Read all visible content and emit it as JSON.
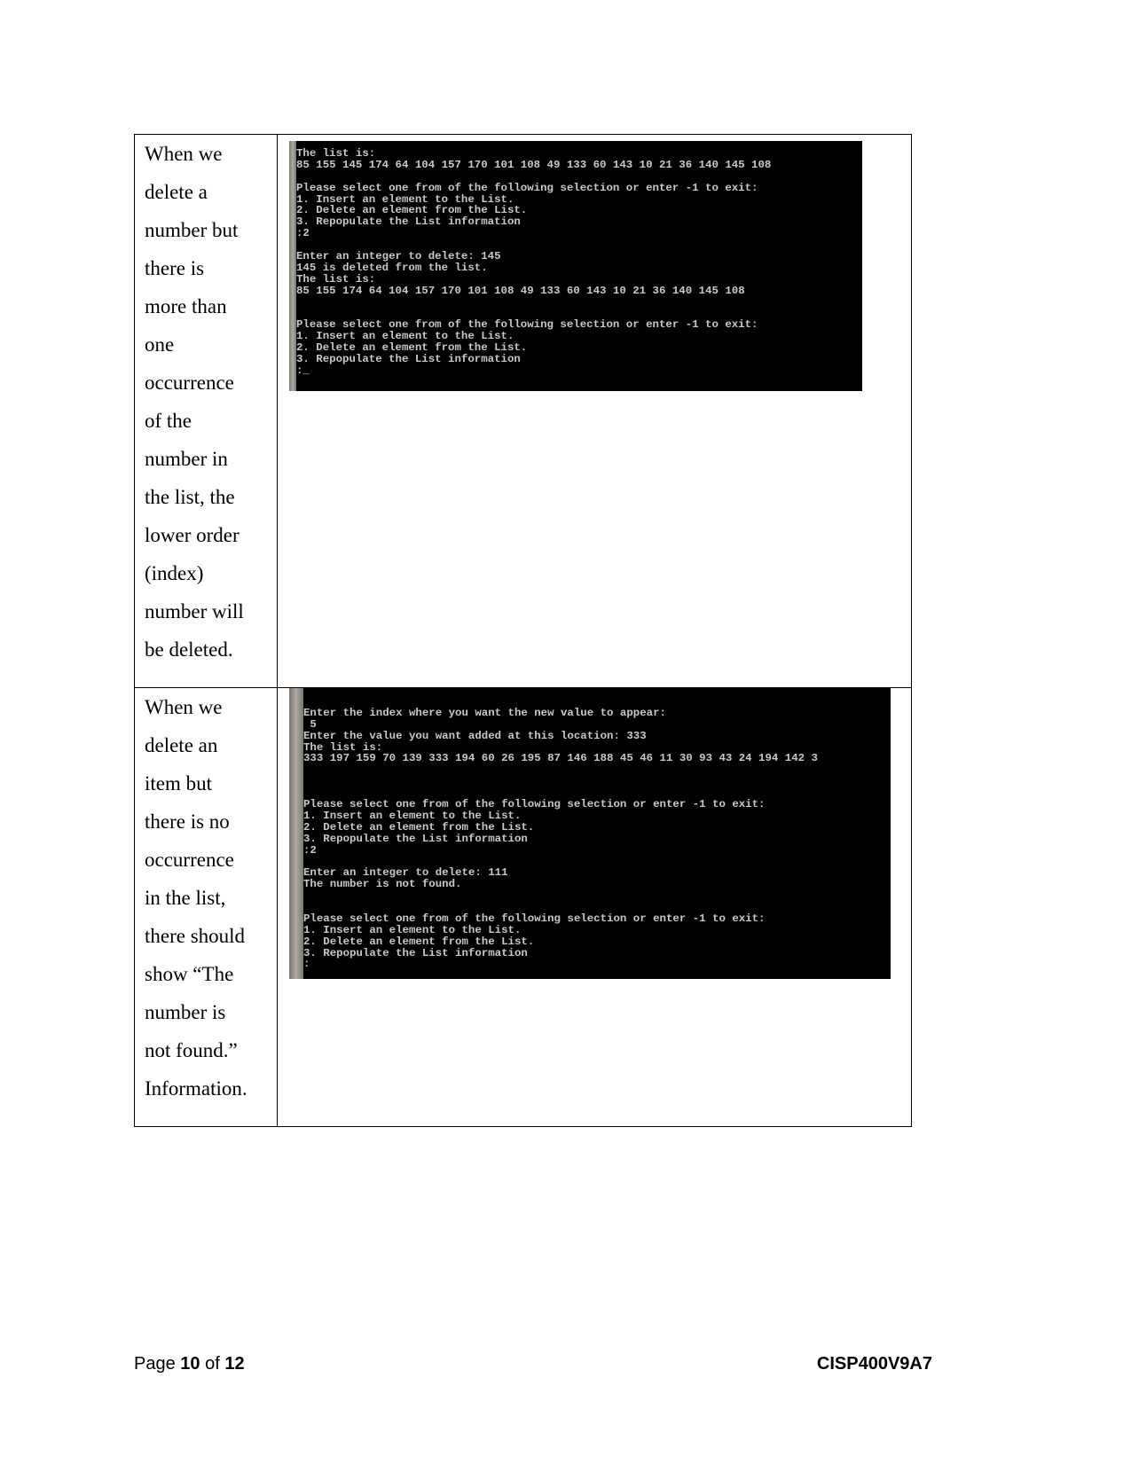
{
  "rows": [
    {
      "description_lines": [
        "When we",
        "delete a",
        "number but",
        "there is",
        "more than",
        "one",
        "occurrence",
        "of the",
        "number in",
        "the list, the",
        "lower order",
        "(index)",
        "number will",
        "be deleted."
      ],
      "console_lines": [
        "The list is:",
        "85 155 145 174 64 104 157 170 101 108 49 133 60 143 10 21 36 140 145 108",
        "",
        "Please select one from of the following selection or enter -1 to exit:",
        "1. Insert an element to the List.",
        "2. Delete an element from the List.",
        "3. Repopulate the List information",
        ":2",
        "",
        "Enter an integer to delete: 145",
        "145 is deleted from the list.",
        "The list is:",
        "85 155 174 64 104 157 170 101 108 49 133 60 143 10 21 36 140 145 108",
        "",
        "",
        "Please select one from of the following selection or enter -1 to exit:",
        "1. Insert an element to the List.",
        "2. Delete an element from the List.",
        "3. Repopulate the List information",
        ":_"
      ]
    },
    {
      "description_lines": [
        "When we",
        "delete an",
        "item but",
        "there is no",
        "occurrence",
        "in the list,",
        "there should",
        "show “The",
        "number is",
        "not found.”",
        "Information."
      ],
      "console_lines": [
        "",
        "Enter the index where you want the new value to appear:",
        " 5",
        "Enter the value you want added at this location: 333",
        "The list is:",
        "333 197 159 70 139 333 194 60 26 195 87 146 188 45 46 11 30 93 43 24 194 142 3",
        "",
        "",
        "",
        "Please select one from of the following selection or enter -1 to exit:",
        "1. Insert an element to the List.",
        "2. Delete an element from the List.",
        "3. Repopulate the List information",
        ":2",
        "",
        "Enter an integer to delete: 111",
        "The number is not found.",
        "",
        "",
        "Please select one from of the following selection or enter -1 to exit:",
        "1. Insert an element to the List.",
        "2. Delete an element from the List.",
        "3. Repopulate the List information",
        ":"
      ]
    }
  ],
  "footer": {
    "page_word": "Page",
    "page_number": "10",
    "of_word": "of",
    "page_total": "12",
    "doc_code": "CISP400V9A7"
  }
}
